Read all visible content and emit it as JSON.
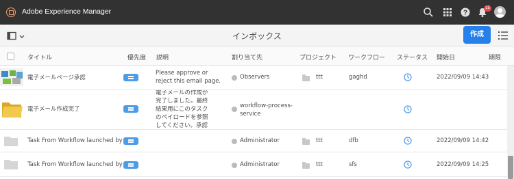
{
  "app": {
    "title": "Adobe Experience Manager",
    "notification_count": "15"
  },
  "actionbar": {
    "title": "インボックス",
    "create_label": "作成"
  },
  "columns": {
    "title": "タイトル",
    "priority": "優先度",
    "description": "説明",
    "assignee": "割り当て先",
    "project": "プロジェクト",
    "workflow": "ワークフロー",
    "status": "ステータス",
    "start_date": "開始日",
    "due_date": "期限"
  },
  "rows": [
    {
      "title": "電子メールページ承認",
      "description": "Please approve or reject this email page.",
      "assignee": "Observers",
      "project": "ttt",
      "workflow": "gaghd",
      "start": "2022/09/09 14:43"
    },
    {
      "title": "電子メール作成完了",
      "description": "電子メールの作成が完了しました。最終結果用にこのタスクのペイロードを参照してください。承認プロセスが",
      "assignee": "workflow-process-service",
      "project": "",
      "workflow": "",
      "start": ""
    },
    {
      "title": "Task From Workflow launched by ...",
      "description": "",
      "assignee": "Administrator",
      "project": "ttt",
      "workflow": "dfb",
      "start": "2022/09/09 14:42"
    },
    {
      "title": "Task From Workflow launched by ...",
      "description": "",
      "assignee": "Administrator",
      "project": "ttt",
      "workflow": "sfs",
      "start": "2022/09/09 14:25"
    }
  ]
}
